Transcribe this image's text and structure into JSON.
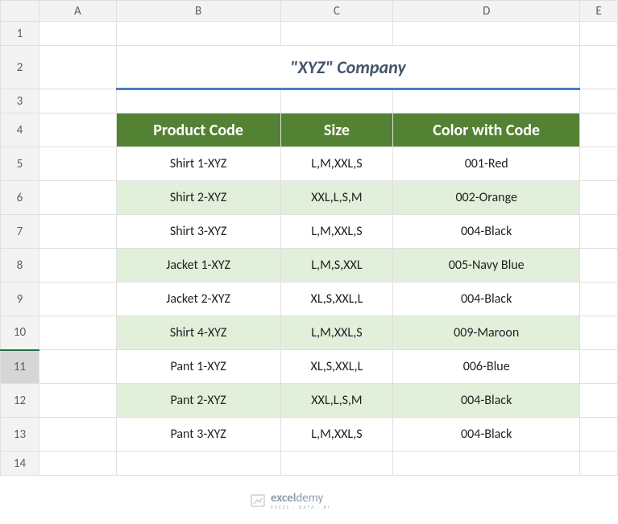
{
  "columns": [
    "A",
    "B",
    "C",
    "D",
    "E"
  ],
  "title": "\"XYZ\" Company",
  "headers": {
    "b": "Product Code",
    "c": "Size",
    "d": "Color with Code"
  },
  "rows": [
    {
      "n": 5,
      "product": "Shirt 1-XYZ",
      "size": "L,M,XXL,S",
      "color": "001-Red",
      "band": false
    },
    {
      "n": 6,
      "product": "Shirt 2-XYZ",
      "size": "XXL,L,S,M",
      "color": "002-Orange",
      "band": true
    },
    {
      "n": 7,
      "product": "Shirt 3-XYZ",
      "size": "L,M,XXL,S",
      "color": "004-Black",
      "band": false
    },
    {
      "n": 8,
      "product": "Jacket 1-XYZ",
      "size": "L,M,S,XXL",
      "color": "005-Navy Blue",
      "band": true
    },
    {
      "n": 9,
      "product": "Jacket 2-XYZ",
      "size": "XL,S,XXL,L",
      "color": "004-Black",
      "band": false
    },
    {
      "n": 10,
      "product": "Shirt 4-XYZ",
      "size": "L,M,XXL,S",
      "color": "009-Maroon",
      "band": true
    },
    {
      "n": 11,
      "product": "Pant 1-XYZ",
      "size": "XL,S,XXL,L",
      "color": "006-Blue",
      "band": false
    },
    {
      "n": 12,
      "product": "Pant 2-XYZ",
      "size": "XXL,L,S,M",
      "color": "004-Black",
      "band": true
    },
    {
      "n": 13,
      "product": "Pant 3-XYZ",
      "size": "L,M,XXL,S",
      "color": "004-Black",
      "band": false
    }
  ],
  "selected_row": 11,
  "watermark": {
    "brand": "exceldemy",
    "tagline": "EXCEL · DATA · BI"
  },
  "chart_data": {
    "type": "table",
    "title": "\"XYZ\" Company",
    "columns": [
      "Product Code",
      "Size",
      "Color with Code"
    ],
    "data": [
      [
        "Shirt 1-XYZ",
        "L,M,XXL,S",
        "001-Red"
      ],
      [
        "Shirt 2-XYZ",
        "XXL,L,S,M",
        "002-Orange"
      ],
      [
        "Shirt 3-XYZ",
        "L,M,XXL,S",
        "004-Black"
      ],
      [
        "Jacket 1-XYZ",
        "L,M,S,XXL",
        "005-Navy Blue"
      ],
      [
        "Jacket 2-XYZ",
        "XL,S,XXL,L",
        "004-Black"
      ],
      [
        "Shirt 4-XYZ",
        "L,M,XXL,S",
        "009-Maroon"
      ],
      [
        "Pant 1-XYZ",
        "XL,S,XXL,L",
        "006-Blue"
      ],
      [
        "Pant 2-XYZ",
        "XXL,L,S,M",
        "004-Black"
      ],
      [
        "Pant 3-XYZ",
        "L,M,XXL,S",
        "004-Black"
      ]
    ]
  }
}
